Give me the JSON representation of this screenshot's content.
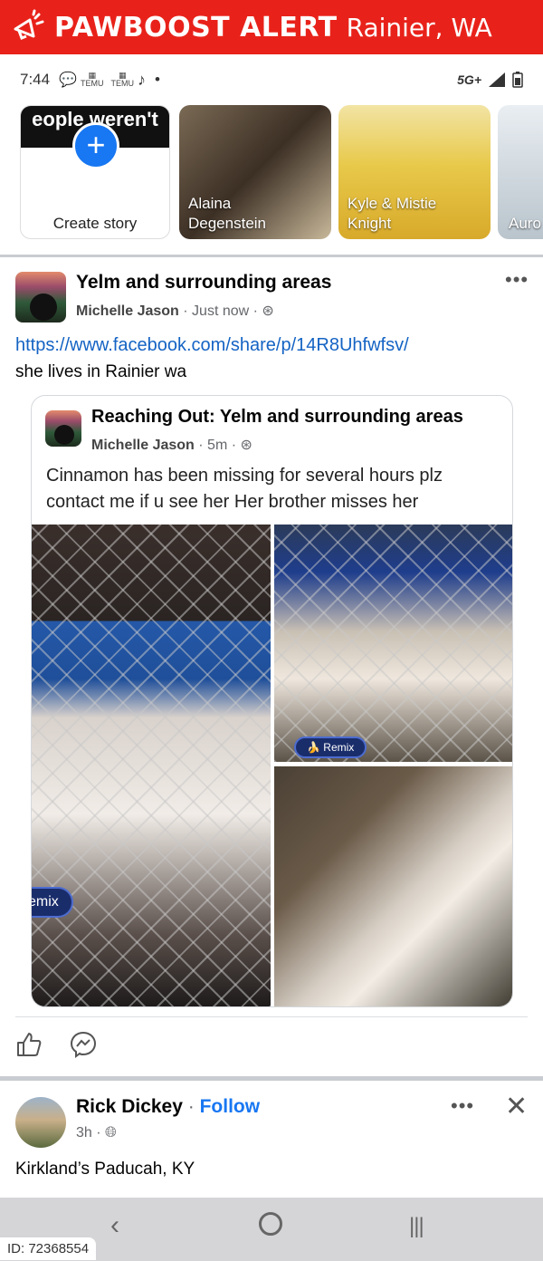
{
  "banner": {
    "brand": "PAWBOOST ALERT",
    "location": "Rainier, WA",
    "color": "#e8221a"
  },
  "status_bar": {
    "time": "7:44",
    "temu1": "TEMU",
    "temu2": "TEMU",
    "network": "5G+"
  },
  "stories": {
    "create_label": "Create story",
    "create_top_text": "eople weren't info",
    "items": [
      {
        "name": "Alaina Degenstein"
      },
      {
        "name": "Kyle & Mistie Knight"
      },
      {
        "name": "Auro"
      }
    ]
  },
  "post": {
    "group": "Yelm and surrounding areas",
    "author": "Michelle Jason",
    "time": "Just now",
    "link": "https://www.facebook.com/share/p/14R8Uhfwfsv/",
    "text": "she lives in Rainier wa",
    "shared": {
      "title": "Reaching Out: Yelm and surrounding areas",
      "author": "Michelle Jason",
      "time": "5m",
      "text": "Cinnamon has been missing for several hours plz contact me if u see her Her brother misses her",
      "remix1": "emix",
      "remix2": "Remix"
    }
  },
  "post2": {
    "name": "Rick Dickey",
    "follow": "Follow",
    "time": "3h",
    "text": "Kirkland’s Paducah, KY"
  },
  "footer": {
    "id": "ID: 72368554"
  },
  "colors": {
    "link": "#1463c4",
    "accent": "#1877f2"
  }
}
